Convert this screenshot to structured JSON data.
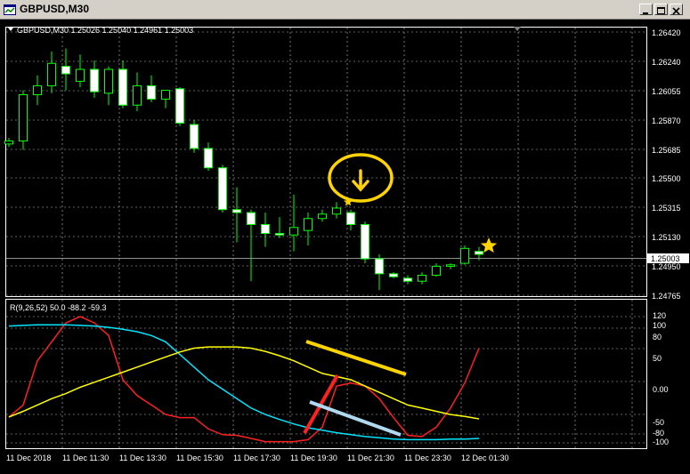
{
  "window": {
    "title": "GBPUSD,M30",
    "controls": [
      "minimize",
      "maximize",
      "close"
    ]
  },
  "price_panel": {
    "symbol_header": "GBPUSD,M30  1.25026 1.25040 1.24961 1.25003",
    "current_price_label": "1.25003",
    "price_axis": [
      "1.26420",
      "1.26240",
      "1.26055",
      "1.25870",
      "1.25685",
      "1.25500",
      "1.25315",
      "1.25130",
      "1.24950",
      "1.24765"
    ]
  },
  "indicator_panel": {
    "header": "R(9,26,52) 50.0 -88.2 -59.3",
    "axis": [
      "120",
      "100",
      "80",
      "50",
      "0.00",
      "-50",
      "-80",
      "-100"
    ]
  },
  "time_axis": [
    "11 Dec 2018",
    "11 Dec 11:30",
    "11 Dec 13:30",
    "11 Dec 15:30",
    "11 Dec 17:30",
    "11 Dec 19:30",
    "11 Dec 21:30",
    "11 Dec 23:30",
    "12 Dec 01:30"
  ],
  "colors": {
    "bull": "#000000",
    "bear": "#ffffff",
    "wick": "#00ff00",
    "grid": "#c0c0c0",
    "fast": "#ff2020",
    "mid": "#ffff00",
    "slow": "#00e5ff",
    "annotation": "#ffd400",
    "selection": "#b0d8f0"
  },
  "chart_data": [
    {
      "type": "candlestick",
      "title": "GBPUSD,M30",
      "ylim": [
        1.2472,
        1.2652
      ],
      "candles": [
        {
          "o": 1.2574,
          "h": 1.2578,
          "l": 1.2572,
          "c": 1.2576
        },
        {
          "o": 1.2576,
          "h": 1.261,
          "l": 1.257,
          "c": 1.2607
        },
        {
          "o": 1.2607,
          "h": 1.262,
          "l": 1.26,
          "c": 1.2613
        },
        {
          "o": 1.2613,
          "h": 1.2636,
          "l": 1.2608,
          "c": 1.2628
        },
        {
          "o": 1.2626,
          "h": 1.2638,
          "l": 1.261,
          "c": 1.2621
        },
        {
          "o": 1.2616,
          "h": 1.2634,
          "l": 1.2612,
          "c": 1.2624
        },
        {
          "o": 1.2624,
          "h": 1.263,
          "l": 1.2605,
          "c": 1.2609
        },
        {
          "o": 1.2608,
          "h": 1.2626,
          "l": 1.26,
          "c": 1.2624
        },
        {
          "o": 1.2624,
          "h": 1.263,
          "l": 1.2598,
          "c": 1.26
        },
        {
          "o": 1.26,
          "h": 1.2622,
          "l": 1.2596,
          "c": 1.2613
        },
        {
          "o": 1.2613,
          "h": 1.262,
          "l": 1.2602,
          "c": 1.2604
        },
        {
          "o": 1.2604,
          "h": 1.261,
          "l": 1.2598,
          "c": 1.261
        },
        {
          "o": 1.2611,
          "h": 1.2612,
          "l": 1.2586,
          "c": 1.2588
        },
        {
          "o": 1.2587,
          "h": 1.259,
          "l": 1.2568,
          "c": 1.2571
        },
        {
          "o": 1.2571,
          "h": 1.2575,
          "l": 1.2556,
          "c": 1.2558
        },
        {
          "o": 1.2558,
          "h": 1.256,
          "l": 1.2528,
          "c": 1.253
        },
        {
          "o": 1.253,
          "h": 1.2545,
          "l": 1.2508,
          "c": 1.2528
        },
        {
          "o": 1.2528,
          "h": 1.253,
          "l": 1.2482,
          "c": 1.252
        },
        {
          "o": 1.252,
          "h": 1.2528,
          "l": 1.2505,
          "c": 1.2514
        },
        {
          "o": 1.2514,
          "h": 1.2525,
          "l": 1.2511,
          "c": 1.2513
        },
        {
          "o": 1.2513,
          "h": 1.254,
          "l": 1.2502,
          "c": 1.2518
        },
        {
          "o": 1.2516,
          "h": 1.2528,
          "l": 1.2506,
          "c": 1.2524
        },
        {
          "o": 1.2524,
          "h": 1.253,
          "l": 1.2522,
          "c": 1.2527
        },
        {
          "o": 1.2527,
          "h": 1.2535,
          "l": 1.2524,
          "c": 1.2531
        },
        {
          "o": 1.2528,
          "h": 1.253,
          "l": 1.2516,
          "c": 1.252
        },
        {
          "o": 1.252,
          "h": 1.2522,
          "l": 1.2494,
          "c": 1.2497
        },
        {
          "o": 1.2497,
          "h": 1.25,
          "l": 1.2476,
          "c": 1.2487
        },
        {
          "o": 1.2487,
          "h": 1.2488,
          "l": 1.2484,
          "c": 1.2485
        },
        {
          "o": 1.2484,
          "h": 1.2486,
          "l": 1.248,
          "c": 1.2482
        },
        {
          "o": 1.2482,
          "h": 1.2488,
          "l": 1.248,
          "c": 1.2486
        },
        {
          "o": 1.2486,
          "h": 1.2494,
          "l": 1.2485,
          "c": 1.2492
        },
        {
          "o": 1.2492,
          "h": 1.2494,
          "l": 1.249,
          "c": 1.2493
        },
        {
          "o": 1.2494,
          "h": 1.2506,
          "l": 1.2493,
          "c": 1.2504
        },
        {
          "o": 1.2502,
          "h": 1.2505,
          "l": 1.2496,
          "c": 1.25
        }
      ]
    },
    {
      "type": "line",
      "title": "R(9,26,52)",
      "ylim": [
        -105,
        120
      ],
      "series": [
        {
          "name": "9",
          "values": [
            -59,
            -40,
            30,
            60,
            90,
            100,
            90,
            70,
            0,
            -25,
            -40,
            -55,
            -60,
            -60,
            -78,
            -87,
            -88,
            -93,
            -98,
            -98,
            -98,
            -95,
            -75,
            -10,
            -5,
            -10,
            -30,
            -60,
            -88,
            -90,
            -75,
            -45,
            -5,
            50
          ]
        },
        {
          "name": "52",
          "values": [
            85,
            86,
            87,
            87,
            87,
            86,
            85,
            83,
            80,
            76,
            70,
            60,
            40,
            20,
            0,
            -15,
            -30,
            -45,
            -55,
            -63,
            -70,
            -76,
            -80,
            -84,
            -87,
            -90,
            -92,
            -94,
            -95,
            -95,
            -95,
            -94,
            -94,
            -93
          ]
        },
        {
          "name": "26",
          "values": [
            -59,
            -50,
            -40,
            -30,
            -22,
            -12,
            -4,
            4,
            12,
            20,
            28,
            36,
            44,
            50,
            52,
            52,
            52,
            50,
            45,
            38,
            30,
            20,
            10,
            5,
            0,
            -10,
            -20,
            -30,
            -40,
            -45,
            -50,
            -55,
            -58,
            -62
          ]
        }
      ]
    }
  ]
}
